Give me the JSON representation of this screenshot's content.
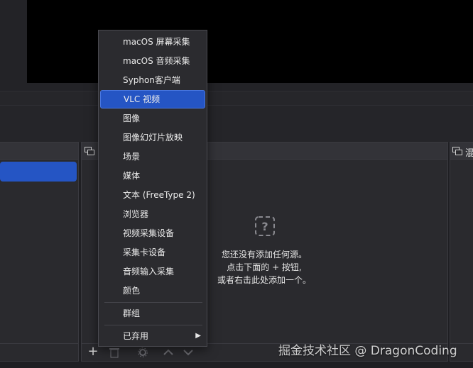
{
  "context_menu": {
    "items": [
      {
        "label": "macOS 屏幕采集"
      },
      {
        "label": "macOS 音频采集"
      },
      {
        "label": "Syphon客户端"
      },
      {
        "label": "VLC 视频",
        "selected": true
      },
      {
        "label": "图像"
      },
      {
        "label": "图像幻灯片放映"
      },
      {
        "label": "场景"
      },
      {
        "label": "媒体"
      },
      {
        "label": "文本 (FreeType 2)"
      },
      {
        "label": "浏览器"
      },
      {
        "label": "视频采集设备"
      },
      {
        "label": "采集卡设备"
      },
      {
        "label": "音频输入采集"
      },
      {
        "label": "颜色"
      }
    ],
    "group_item": {
      "label": "群组"
    },
    "deprecated_item": {
      "label": "已弃用",
      "has_submenu": true
    }
  },
  "sources_dock": {
    "empty_line1": "您还没有添加任何源。",
    "empty_line2": "点击下面的 + 按钮,",
    "empty_line3": "或者右击此处添加一个。",
    "add_label": "+"
  },
  "mixer_dock": {
    "title_partial": "混"
  },
  "watermark": "掘金技术社区 @ DragonCoding",
  "colors": {
    "accent": "#2555c4",
    "background": "#1f1f23",
    "panel": "#2a2a2e",
    "menu_bg": "#2b2b2f"
  }
}
